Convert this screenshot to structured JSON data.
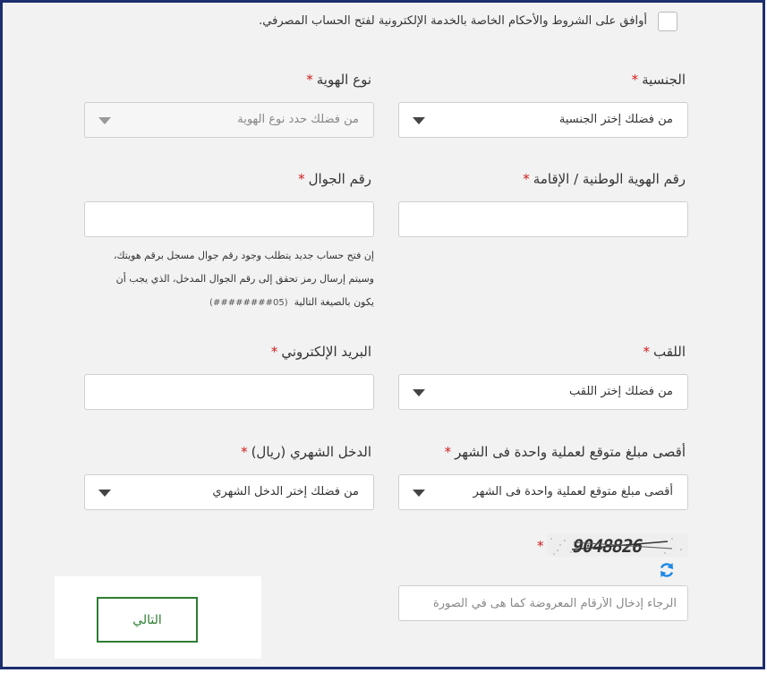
{
  "agreement": {
    "label": "أوافق على الشروط والأحكام الخاصة بالخدمة الإلكترونية لفتح الحساب المصرفي."
  },
  "nationality": {
    "label": "الجنسية",
    "value": "من فضلك إختر الجنسية"
  },
  "id_type": {
    "label": "نوع الهوية",
    "value": "من فضلك حدد نوع الهوية"
  },
  "national_id": {
    "label": "رقم الهوية الوطنية / الإقامة",
    "value": ""
  },
  "mobile": {
    "label": "رقم الجوال",
    "value": "",
    "note_line1": "إن فتح حساب جديد يتطلب وجود رقم جوال مسجل برقم هويتك،",
    "note_line2": "وسيتم إرسال رمز تحقق إلى رقم الجوال المدخل، الذي يجب أن",
    "note_line3": "يكون بالصيغة التالية",
    "note_format": "(05########)"
  },
  "title": {
    "label": "اللقب",
    "value": "من فضلك إختر اللقب"
  },
  "email": {
    "label": "البريد الإلكتروني",
    "value": ""
  },
  "max_amount": {
    "label": "أقصى مبلغ متوقع لعملية واحدة فى الشهر",
    "value": "أقصى مبلغ متوقع لعملية واحدة فى الشهر"
  },
  "income": {
    "label": "الدخل الشهري (ريال)",
    "value": "من فضلك إختر الدخل الشهري"
  },
  "captcha": {
    "placeholder": "الرجاء إدخال الأرقام المعروضة كما هى في الصورة",
    "code": "9048826"
  },
  "required_mark": "*",
  "next_button": "التالي",
  "colors": {
    "frame_border": "#1c2e6e",
    "required": "#d11a1a",
    "next_button": "#2e7d32",
    "refresh_icon": "#1e88e5"
  }
}
